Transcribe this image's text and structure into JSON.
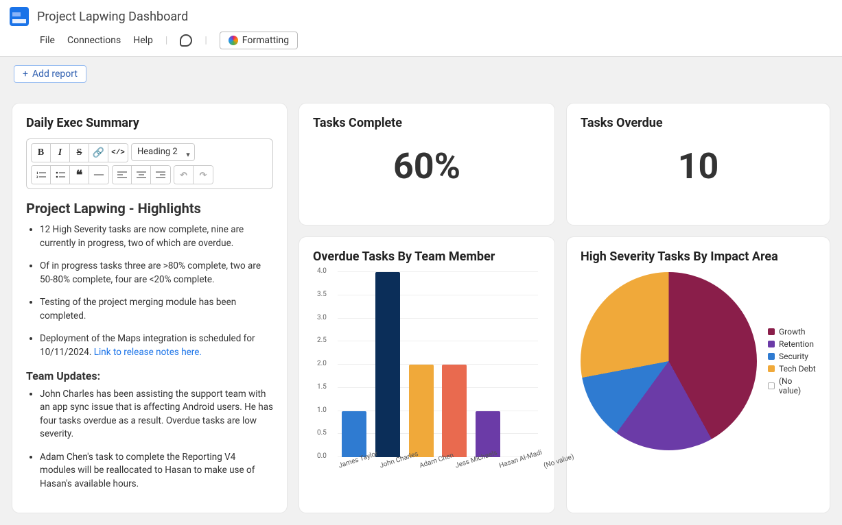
{
  "header": {
    "title": "Project Lapwing Dashboard",
    "menu": {
      "file": "File",
      "connections": "Connections",
      "help": "Help",
      "formatting": "Formatting"
    },
    "add_report": "Add report"
  },
  "toolbar": {
    "heading_select": "Heading 2"
  },
  "editor": {
    "title": "Daily Exec Summary",
    "h3": "Project Lapwing - Highlights",
    "bullets": [
      "12 High Severity tasks are now complete, nine are currently in progress, two of which are overdue.",
      "Of in progress tasks three are >80% complete,  two are     50-80% complete, four are <20% complete.",
      "Testing of the project merging module has been completed.",
      "Deployment of the Maps integration is scheduled for 10/11/2024. "
    ],
    "bullet4_link": "Link to release notes here.",
    "h4": "Team Updates:",
    "team_bullets": [
      "John Charles has been assisting the support team with an app sync issue that is affecting Android users. He has four tasks overdue as a result. Overdue tasks are low severity.",
      "Adam Chen's task to complete the Reporting V4 modules will be reallocated to Hasan to make use of Hasan's available hours."
    ]
  },
  "kpi": {
    "complete_title": "Tasks Complete",
    "complete_value": "60%",
    "overdue_title": "Tasks Overdue",
    "overdue_value": "10"
  },
  "bar": {
    "title": "Overdue Tasks By Team Member"
  },
  "pie": {
    "title": "High Severity Tasks By Impact Area"
  },
  "chart_data": [
    {
      "type": "bar",
      "title": "Overdue Tasks By Team Member",
      "ylim": [
        0,
        4
      ],
      "ticks": [
        0,
        0.5,
        1.0,
        1.5,
        2.0,
        2.5,
        3.0,
        3.5,
        4.0
      ],
      "categories": [
        "James Taylor",
        "John Charles",
        "Adam Chen",
        "Jess Michaels",
        "Hasan Al-Madi",
        "(No value)"
      ],
      "values": [
        1,
        4,
        2,
        2,
        1,
        0
      ],
      "colors": [
        "#2f7bd1",
        "#0b2e59",
        "#f0a93a",
        "#e96a4f",
        "#6b3ba7",
        "#888"
      ]
    },
    {
      "type": "pie",
      "title": "High Severity Tasks By Impact Area",
      "series": [
        {
          "name": "Growth",
          "value": 42,
          "color": "#8a1e4a"
        },
        {
          "name": "Retention",
          "value": 18,
          "color": "#6b3ba7"
        },
        {
          "name": "Security",
          "value": 12,
          "color": "#2f7bd1"
        },
        {
          "name": "Tech Debt",
          "value": 28,
          "color": "#f0a93a"
        },
        {
          "name": "(No value)",
          "value": 0,
          "color": "#ffffff"
        }
      ]
    }
  ]
}
